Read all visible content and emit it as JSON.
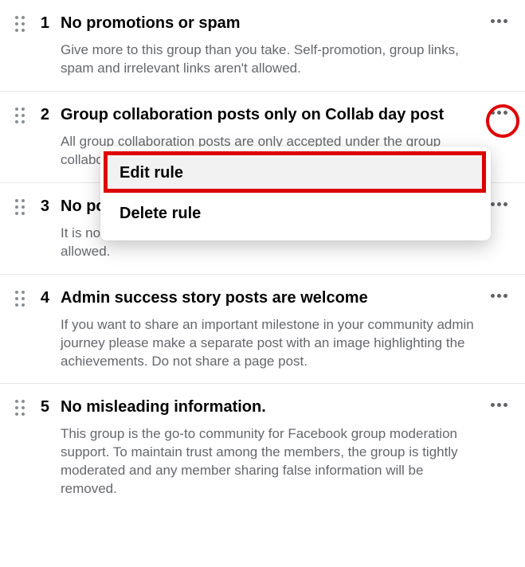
{
  "rules": [
    {
      "number": "1",
      "title": "No promotions or spam",
      "description": "Give more to this group than you take. Self-promotion, group links, spam and irrelevant links aren't allowed."
    },
    {
      "number": "2",
      "title": "Group collaboration posts only on Collab day post",
      "description": "All group collaboration posts are only accepted under the group collaboration day post."
    },
    {
      "number": "3",
      "title": "No posts to sell the groups will be allowed",
      "description": "It is not allowed to sell your group. All posts on this subject will not be allowed."
    },
    {
      "number": "4",
      "title": "Admin success story posts are welcome",
      "description": "If you want to share an important milestone in your community admin journey please make a separate post with an image highlighting the achievements. Do not share a page post."
    },
    {
      "number": "5",
      "title": "No misleading information.",
      "description": "This group is the go-to community for Facebook group moderation support. To maintain trust among the members, the group is tightly moderated and any member sharing false information will be removed."
    }
  ],
  "menu": {
    "edit": "Edit rule",
    "delete": "Delete rule"
  }
}
